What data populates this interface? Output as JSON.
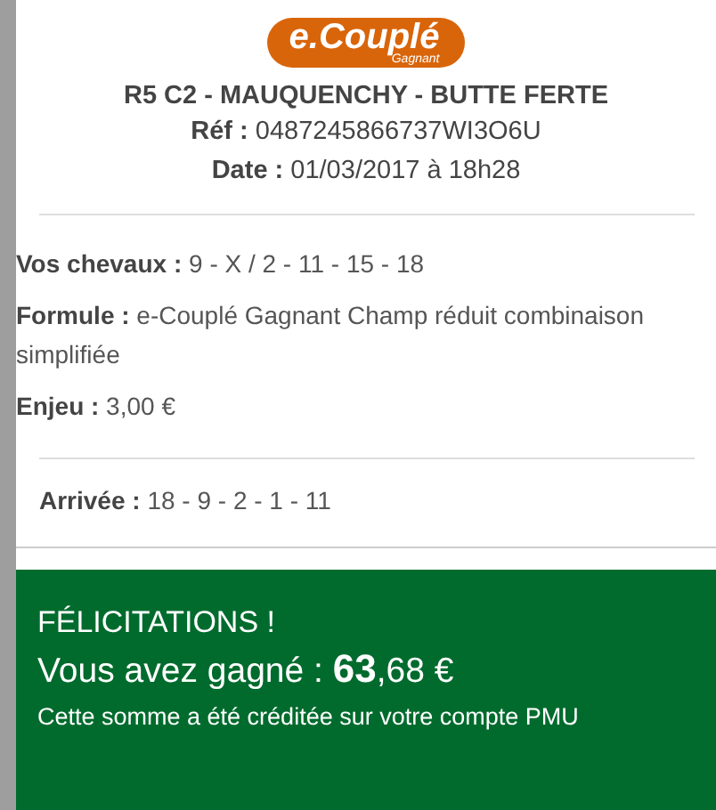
{
  "logo": {
    "text": "e.Couplé",
    "subtext": "Gagnant"
  },
  "race": {
    "title": "R5 C2 - MAUQUENCHY - BUTTE FERTE",
    "reference": "**Réf :** 0487245866737WI3O6U",
    "date": "**Date :** 01/03/2017 à 18h28"
  },
  "bet_details": [
    "**Vos chevaux :** 9 - X / 2 - 11 - 15 - 18",
    "**Formule :** e-Couplé Gagnant Champ réduit combinaison simplifiée",
    "**Enjeu :** 3,00 €"
  ],
  "result": "**Arrivée :** 18 - 9 - 2 - 1 - 11",
  "winnings": {
    "heading": "FÉLICITATIONS !",
    "amount": "Vous avez gagné : **63**,68 €",
    "note": "Cette somme a été créditée sur votre compte PMU"
  }
}
